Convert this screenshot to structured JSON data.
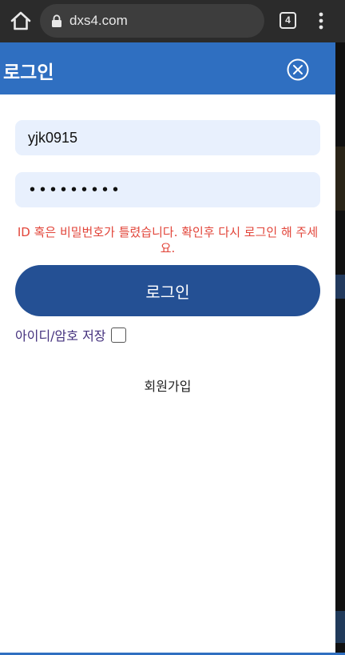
{
  "browser": {
    "url": "dxs4.com",
    "tab_count": "4"
  },
  "modal": {
    "title": "로그인",
    "username_value": "yjk0915",
    "password_mask": "•••••••••",
    "error_message": "ID 혹은 비밀번호가 틀렸습니다. 확인후 다시 로그인 해 주세요.",
    "login_button_label": "로그인",
    "remember_label": "아이디/암호 저장",
    "remember_checked": false,
    "signup_label": "회원가입"
  },
  "colors": {
    "header_blue": "#2f6fc1",
    "button_blue": "#245094",
    "error_red": "#e2453a",
    "field_bg": "#e8f0fd"
  }
}
